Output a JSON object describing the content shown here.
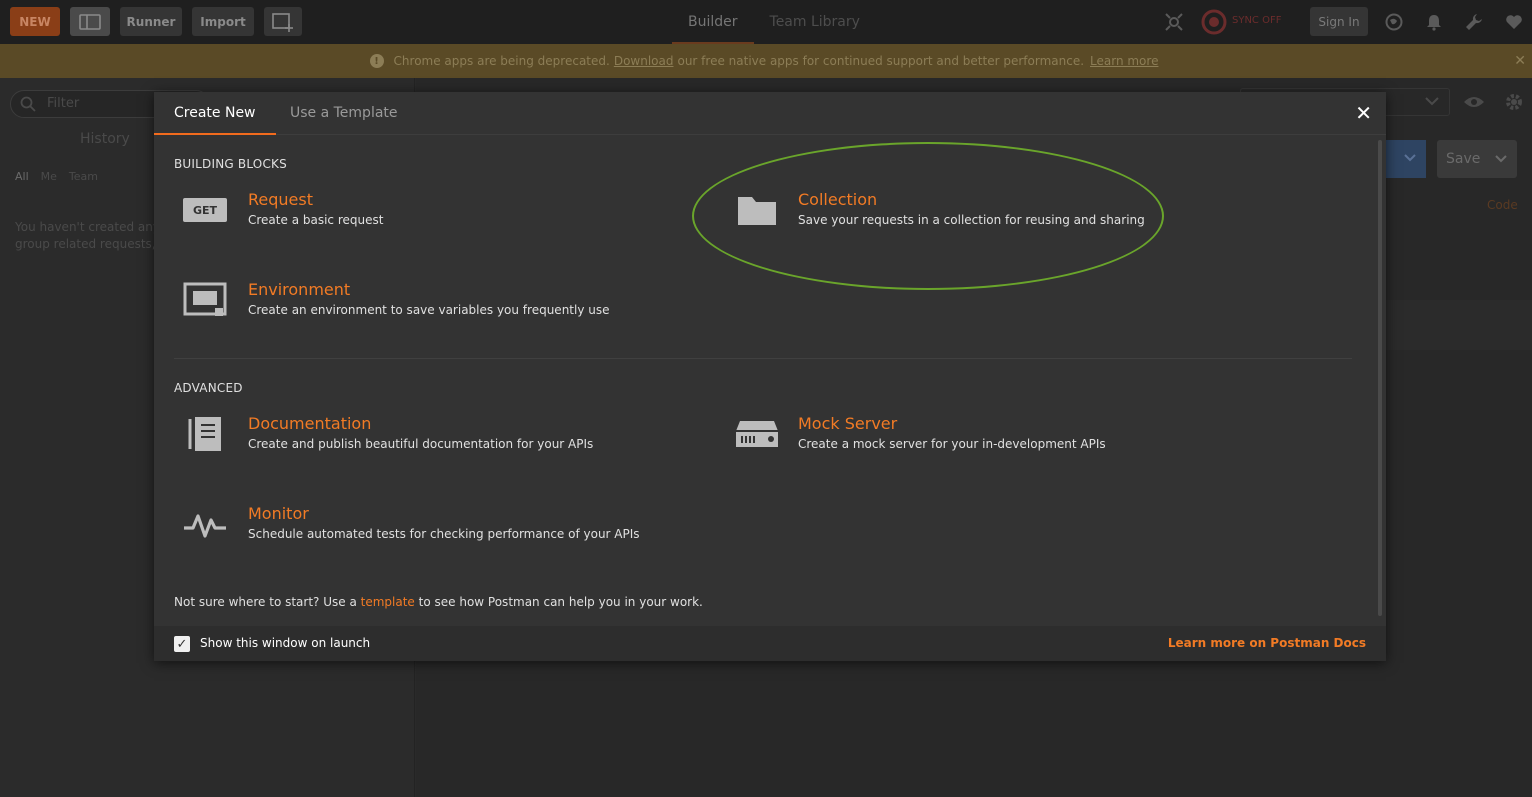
{
  "topbar": {
    "new_label": "NEW",
    "runner_label": "Runner",
    "import_label": "Import",
    "tabs": [
      {
        "label": "Builder"
      },
      {
        "label": "Team Library"
      }
    ],
    "sync_label": "SYNC OFF",
    "signin_label": "Sign In"
  },
  "banner": {
    "text_before": "Chrome apps are being deprecated.",
    "download_link": "Download",
    "text_after": "our free native apps for continued support and better performance.",
    "learn_more": "Learn more"
  },
  "sidebar": {
    "filter_placeholder": "Filter",
    "history_label": "History",
    "filters": [
      "All",
      "Me",
      "Team"
    ],
    "empty_line1": "You haven't created any collections yet.",
    "empty_line2": "group related requests, making them"
  },
  "background": {
    "save_label": "Save",
    "code_label": "Code"
  },
  "modal": {
    "tabs": [
      {
        "label": "Create New"
      },
      {
        "label": "Use a Template"
      }
    ],
    "building_blocks_heading": "BUILDING BLOCKS",
    "advanced_heading": "ADVANCED",
    "items": {
      "request": {
        "title": "Request",
        "desc": "Create a basic request",
        "badge": "GET"
      },
      "collection": {
        "title": "Collection",
        "desc": "Save your requests in a collection for reusing and sharing"
      },
      "environment": {
        "title": "Environment",
        "desc": "Create an environment to save variables you frequently use"
      },
      "documentation": {
        "title": "Documentation",
        "desc": "Create and publish beautiful documentation for your APIs"
      },
      "mock_server": {
        "title": "Mock Server",
        "desc": "Create a mock server for your in-development APIs"
      },
      "monitor": {
        "title": "Monitor",
        "desc": "Schedule automated tests for checking performance of your APIs"
      }
    },
    "hint_before": "Not sure where to start? Use a",
    "hint_link": "template",
    "hint_after": "to see how Postman can help you in your work.",
    "footer": {
      "checkbox_label": "Show this window on launch",
      "checked": true,
      "docs_link": "Learn more on Postman Docs"
    }
  },
  "colors": {
    "accent": "#f27b25",
    "highlight": "#6aa52b"
  }
}
